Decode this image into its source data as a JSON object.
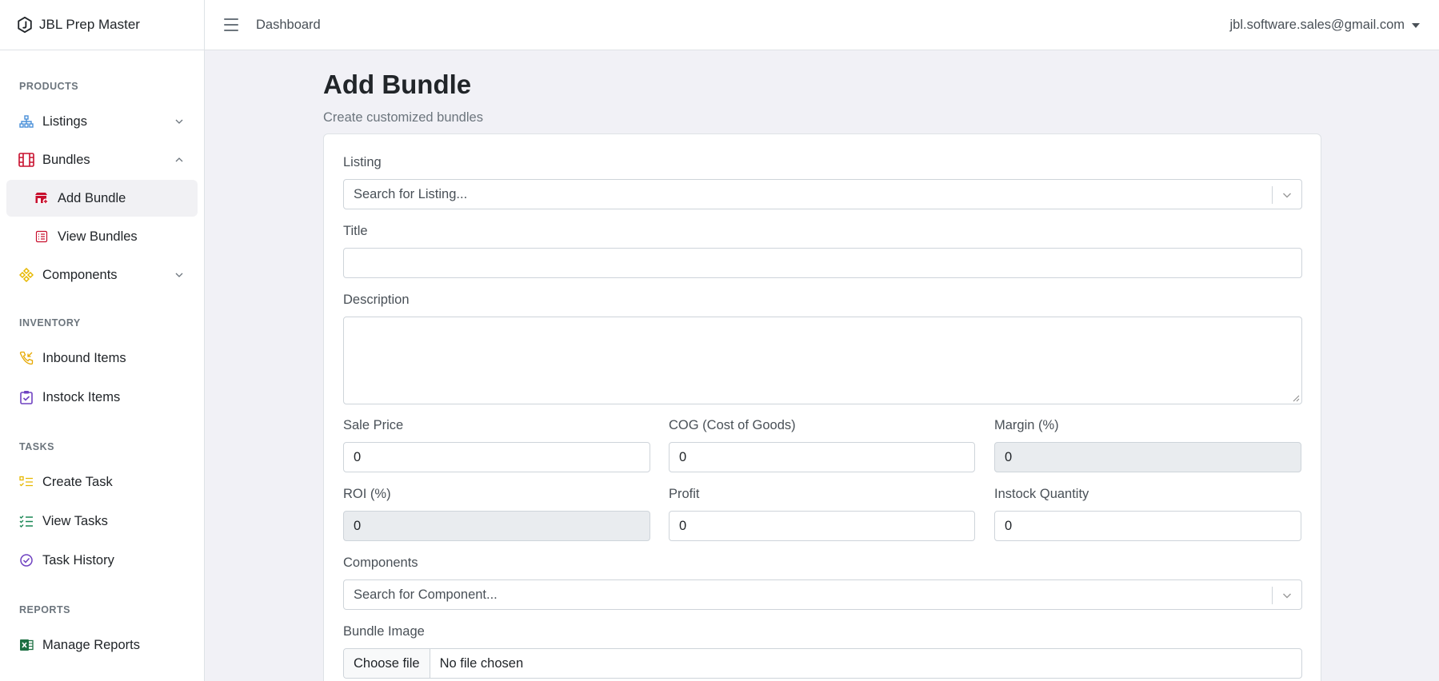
{
  "app": {
    "title": "JBL Prep Master"
  },
  "header": {
    "breadcrumb": "Dashboard",
    "user_email": "jbl.software.sales@gmail.com"
  },
  "sidebar": {
    "sections": [
      {
        "label": "PRODUCTS"
      },
      {
        "label": "INVENTORY"
      },
      {
        "label": "TASKS"
      },
      {
        "label": "REPORTS"
      }
    ],
    "items": {
      "listings": "Listings",
      "bundles": "Bundles",
      "add_bundle": "Add Bundle",
      "view_bundles": "View Bundles",
      "components": "Components",
      "inbound_items": "Inbound Items",
      "instock_items": "Instock Items",
      "create_task": "Create Task",
      "view_tasks": "View Tasks",
      "task_history": "Task History",
      "manage_reports": "Manage Reports"
    }
  },
  "page": {
    "title": "Add Bundle",
    "subtitle": "Create customized bundles"
  },
  "form": {
    "listing": {
      "label": "Listing",
      "placeholder": "Search for Listing..."
    },
    "title": {
      "label": "Title",
      "value": ""
    },
    "description": {
      "label": "Description",
      "value": ""
    },
    "sale_price": {
      "label": "Sale Price",
      "value": "0"
    },
    "cog": {
      "label": "COG (Cost of Goods)",
      "value": "0"
    },
    "margin": {
      "label": "Margin (%)",
      "value": "0"
    },
    "roi": {
      "label": "ROI (%)",
      "value": "0"
    },
    "profit": {
      "label": "Profit",
      "value": "0"
    },
    "instock_quantity": {
      "label": "Instock Quantity",
      "value": "0"
    },
    "components": {
      "label": "Components",
      "placeholder": "Search for Component..."
    },
    "bundle_image": {
      "label": "Bundle Image",
      "button": "Choose file",
      "file_status": "No file chosen"
    }
  },
  "colors": {
    "listings_icon": "#4a90d9",
    "bundles_icon": "#c8102e",
    "components_icon": "#e6b800",
    "inbound_icon": "#e6a800",
    "instock_icon": "#6f42c1",
    "create_task_icon": "#e6b800",
    "view_tasks_icon": "#198754",
    "task_history_icon": "#6f42c1",
    "reports_icon": "#1d6f42"
  }
}
